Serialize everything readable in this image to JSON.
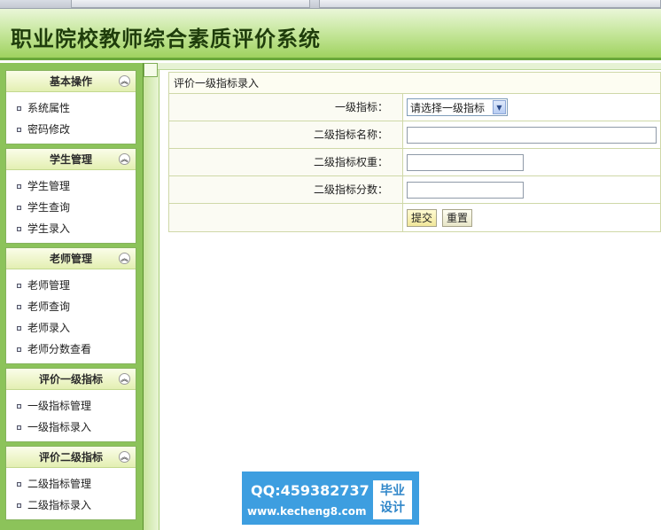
{
  "app": {
    "title": "职业院校教师综合素质评价系统"
  },
  "sidebar": {
    "panels": [
      {
        "title": "基本操作",
        "items": [
          "系统属性",
          "密码修改"
        ]
      },
      {
        "title": "学生管理",
        "items": [
          "学生管理",
          "学生查询",
          "学生录入"
        ]
      },
      {
        "title": "老师管理",
        "items": [
          "老师管理",
          "老师查询",
          "老师录入",
          "老师分数查看"
        ]
      },
      {
        "title": "评价一级指标",
        "items": [
          "一级指标管理",
          "一级指标录入"
        ]
      },
      {
        "title": "评价二级指标",
        "items": [
          "二级指标管理",
          "二级指标录入"
        ]
      }
    ],
    "collapse_glyph": "︽"
  },
  "form": {
    "caption": "评价一级指标录入",
    "rows": {
      "level1": {
        "label": "一级指标：",
        "selected": "请选择一级指标"
      },
      "name": {
        "label": "二级指标名称：",
        "value": ""
      },
      "weight": {
        "label": "二级指标权重：",
        "value": ""
      },
      "score": {
        "label": "二级指标分数：",
        "value": ""
      }
    },
    "submit_label": "提交",
    "reset_label": "重置"
  },
  "watermark": {
    "qq": "QQ:459382737",
    "url": "www.kecheng8.com",
    "badge_line1": "毕业",
    "badge_line2": "设计"
  }
}
